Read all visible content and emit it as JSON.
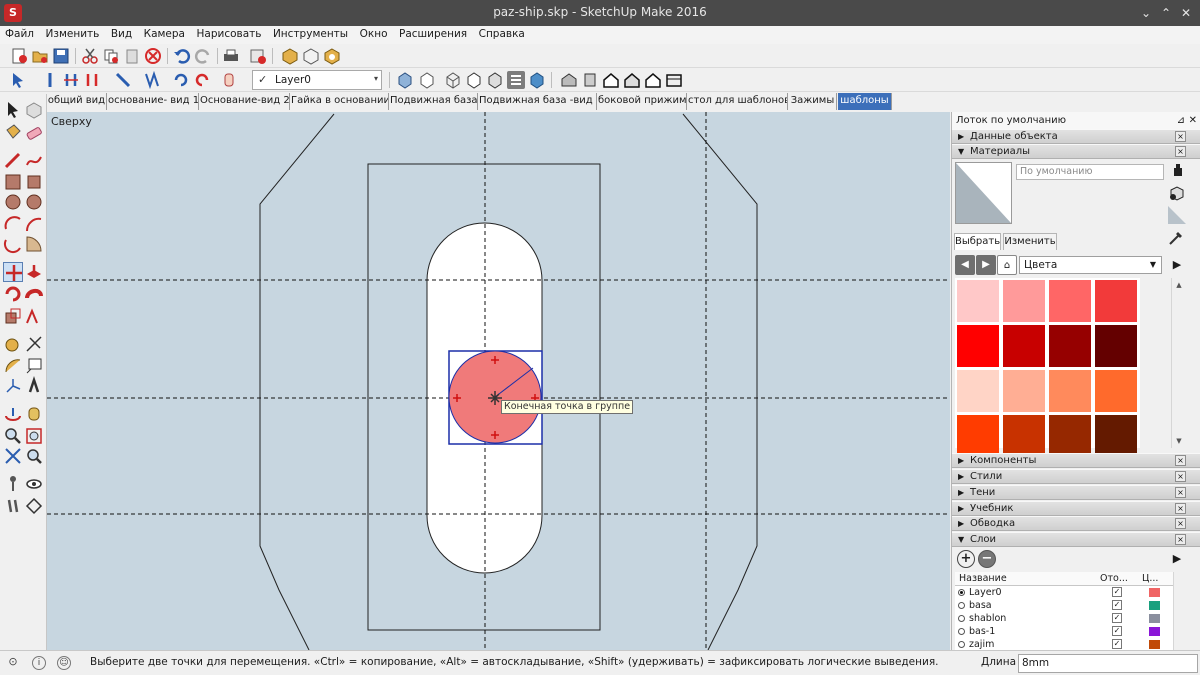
{
  "window": {
    "title": "paz-ship.skp - SketchUp Make 2016",
    "logo_glyph": "S",
    "minimize_glyph": "⌄",
    "maximize_glyph": "⌃",
    "close_glyph": "✕"
  },
  "menu": [
    "Файл",
    "Изменить",
    "Вид",
    "Камера",
    "Нарисовать",
    "Инструменты",
    "Окно",
    "Расширения",
    "Справка"
  ],
  "layer_toolbar": {
    "check": "✓",
    "current_layer": "Layer0",
    "arrow": "▾"
  },
  "scenes": [
    "общий вид",
    "основание- вид 1",
    "Основание-вид 2",
    "Гайка в основании",
    "Подвижная база",
    "Подвижная база -вид 2",
    "боковой прижим",
    "стол для шаблонов",
    "Зажимы",
    "шаблоны"
  ],
  "active_scene": 9,
  "viewport": {
    "view_name": "Сверху",
    "tooltip": "Конечная точка в группе"
  },
  "tray": {
    "title": "Лоток по умолчанию",
    "pin": "⊿",
    "close": "✕",
    "entity_info": "Данные объекта",
    "materials": "Материалы",
    "material_name_placeholder": "По умолчанию",
    "tab_select": "Выбрать",
    "tab_edit": "Изменить",
    "collection": "Цвета",
    "nav_back": "◀",
    "nav_forward": "▶",
    "home_icon": "⌂",
    "details_arrow": "▶",
    "collapsed_panels": [
      "Компоненты",
      "Стили",
      "Тени",
      "Учебник",
      "Обводка"
    ],
    "layers_panel": "Слои",
    "layer_columns": {
      "name": "Название",
      "visible": "Ото...",
      "color": "Ц..."
    },
    "layers": [
      {
        "name": "Layer0",
        "active": true,
        "visible": true,
        "color": "#f06464"
      },
      {
        "name": "basa",
        "active": false,
        "visible": true,
        "color": "#1aa07e"
      },
      {
        "name": "shablon",
        "active": false,
        "visible": true,
        "color": "#8a8f9e"
      },
      {
        "name": "bas-1",
        "active": false,
        "visible": true,
        "color": "#8a16d8"
      },
      {
        "name": "zajim",
        "active": false,
        "visible": true,
        "color": "#c14a08"
      }
    ]
  },
  "swatches": [
    "#ffc8c8",
    "#ff9a9a",
    "#ff6666",
    "#f23a3a",
    "#ff0000",
    "#c80000",
    "#960000",
    "#640000",
    "#ffd4c6",
    "#ffae94",
    "#ff8a5c",
    "#ff6a2c",
    "#ff3c00",
    "#c83200",
    "#962800",
    "#641a00"
  ],
  "status": {
    "message": "Выберите две точки для перемещения.  «Ctrl» = копирование, «Alt» = автоскладывание, «Shift» (удерживать) = зафиксировать логические выведения.",
    "measure_label": "Длина",
    "measure_value": "8mm",
    "info_glyph": "i",
    "user_glyph": "☺",
    "geo_glyph": "⊙"
  }
}
